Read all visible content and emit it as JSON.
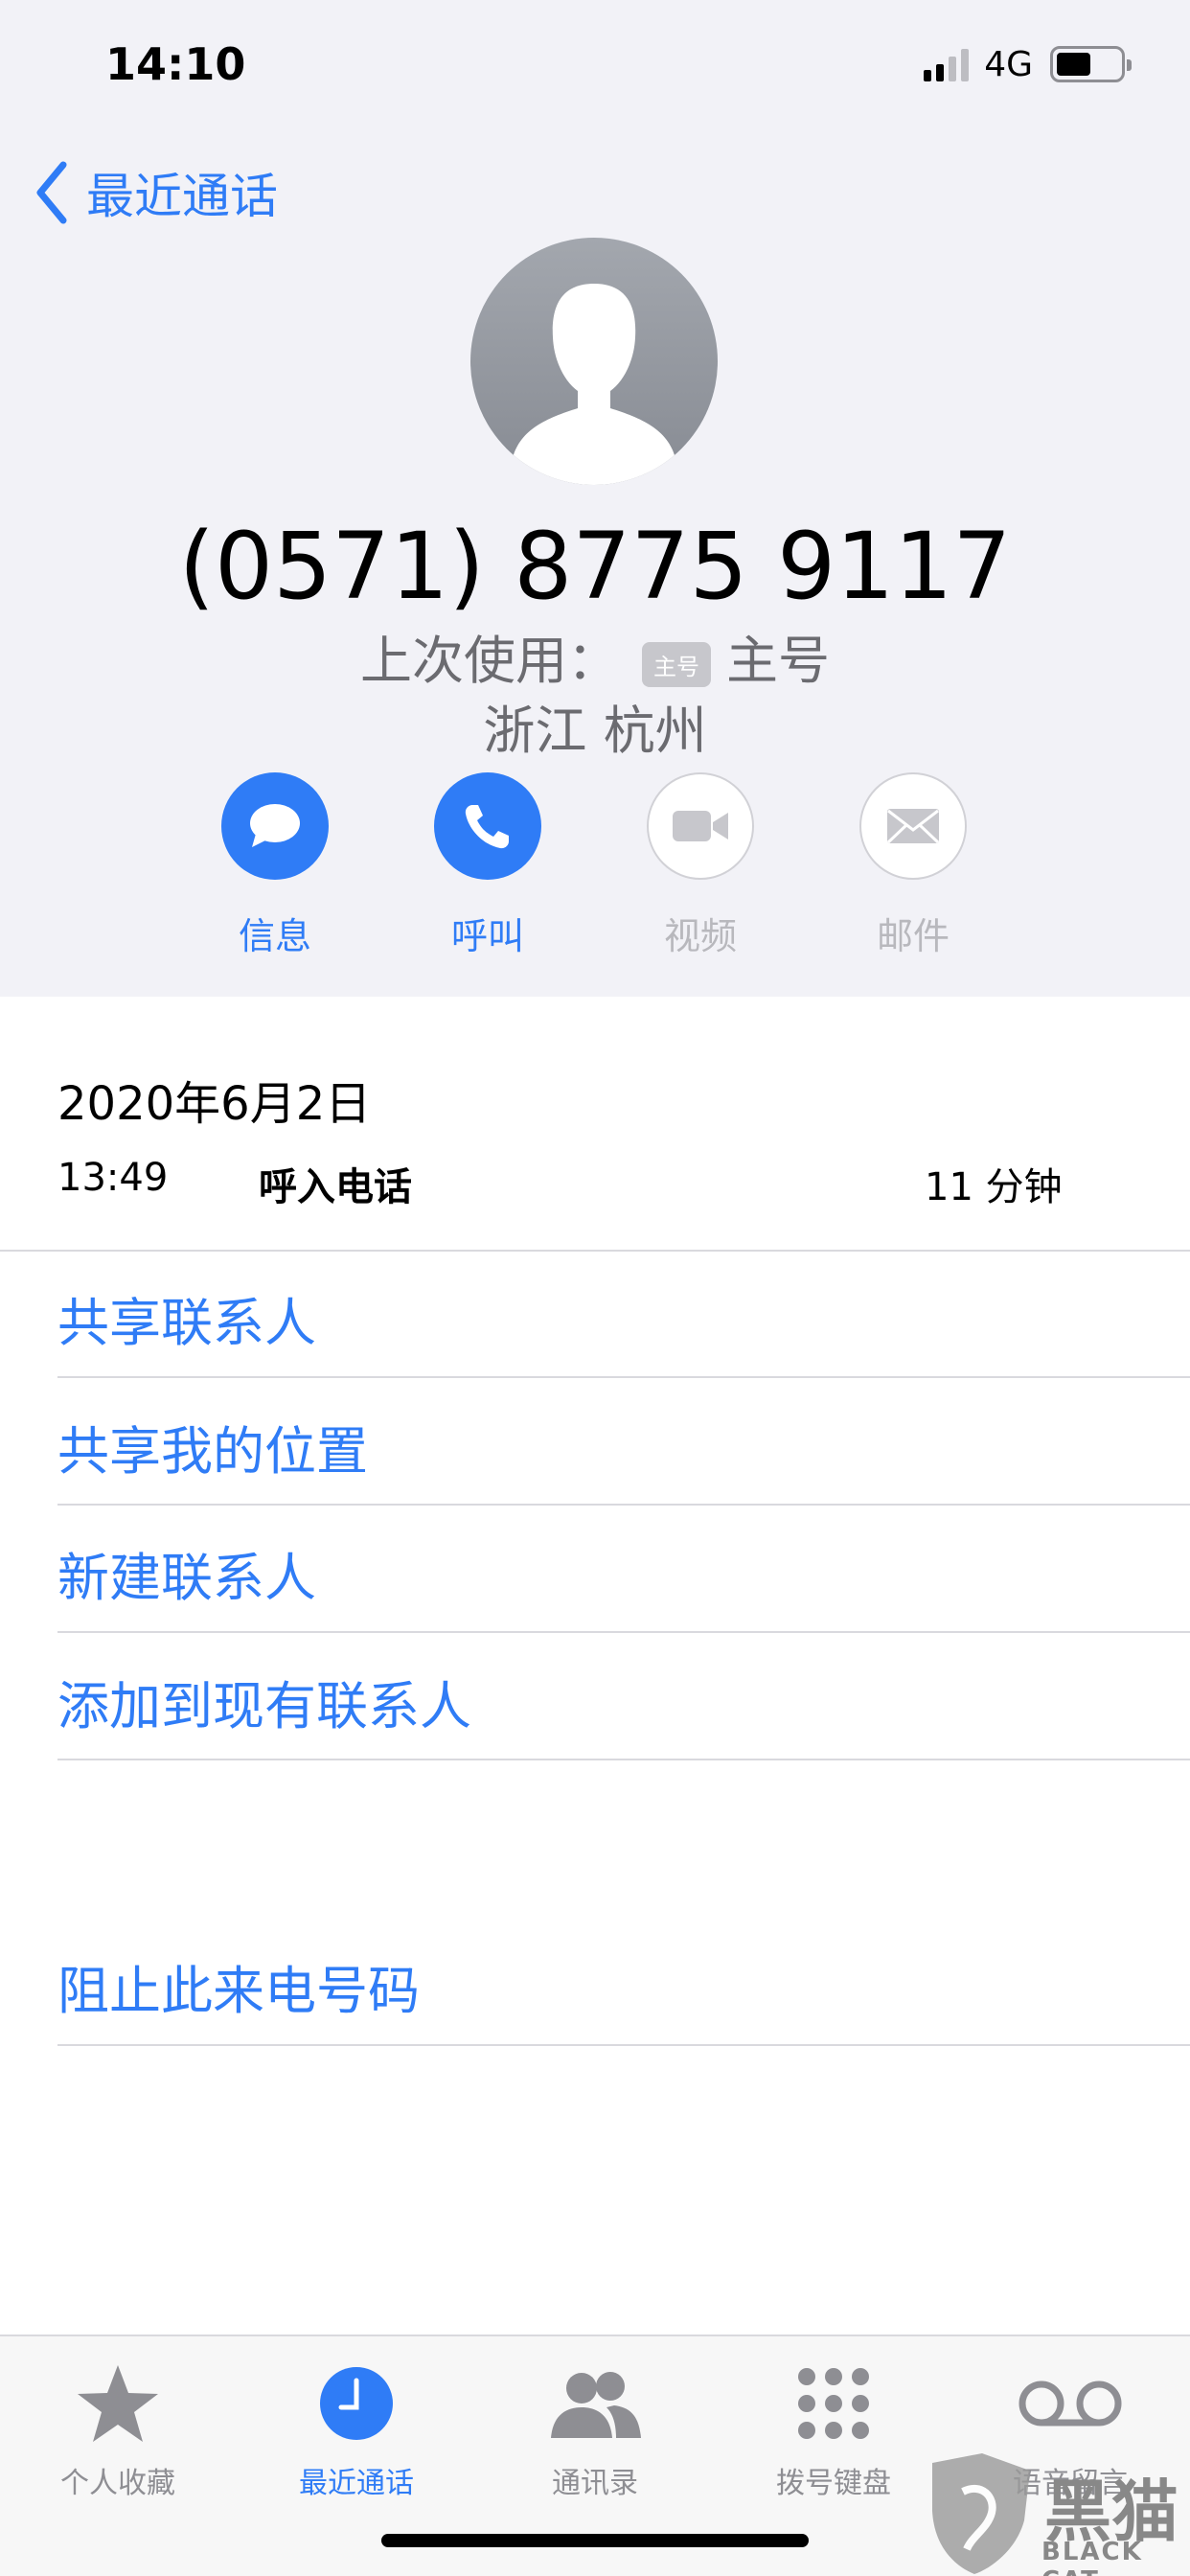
{
  "status_bar": {
    "time": "14:10",
    "network": "4G"
  },
  "nav": {
    "back_label": "最近通话"
  },
  "contact": {
    "phone": "(0571) 8775 9117",
    "last_used_label": "上次使用：",
    "badge": "主号",
    "line_name": "主号",
    "location": "浙江 杭州"
  },
  "actions": [
    {
      "label": "信息",
      "icon": "message-icon",
      "enabled": true
    },
    {
      "label": "呼叫",
      "icon": "phone-icon",
      "enabled": true
    },
    {
      "label": "视频",
      "icon": "video-icon",
      "enabled": false
    },
    {
      "label": "邮件",
      "icon": "mail-icon",
      "enabled": false
    }
  ],
  "call": {
    "date": "2020年6月2日",
    "time": "13:49",
    "type": "呼入电话",
    "duration": "11 分钟"
  },
  "links": [
    "共享联系人",
    "共享我的位置",
    "新建联系人",
    "添加到现有联系人"
  ],
  "block": "阻止此来电号码",
  "tabs": [
    {
      "label": "个人收藏",
      "icon": "star-icon",
      "active": false
    },
    {
      "label": "最近通话",
      "icon": "clock-icon",
      "active": true
    },
    {
      "label": "通讯录",
      "icon": "contacts-icon",
      "active": false
    },
    {
      "label": "拨号键盘",
      "icon": "keypad-icon",
      "active": false
    },
    {
      "label": "语音留言",
      "icon": "voicemail-icon",
      "active": false
    }
  ],
  "watermark": {
    "text": "黑猫",
    "sub": "BLACK CAT"
  },
  "colors": {
    "accent": "#2f7cf6",
    "header_bg": "#f2f2f7",
    "disabled": "#b8b8bd"
  }
}
